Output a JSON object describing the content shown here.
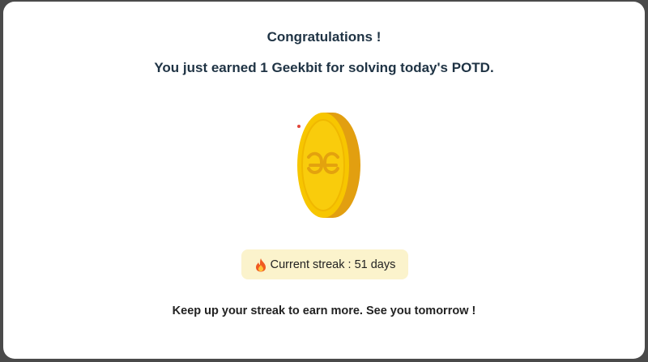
{
  "modal": {
    "title": "Congratulations !",
    "subtitle": "You just earned 1 Geekbit for solving today's POTD.",
    "streak_label": "Current streak : 51 days",
    "footer": "Keep up your streak to earn more. See you tomorrow !"
  },
  "icons": {
    "coin": "geekbit-coin-icon",
    "streak": "fire-icon"
  },
  "colors": {
    "coin_face": "#F7C600",
    "coin_edge": "#E0A100",
    "streak_bg": "#FBF3CC",
    "text_dark": "#1F3344"
  }
}
